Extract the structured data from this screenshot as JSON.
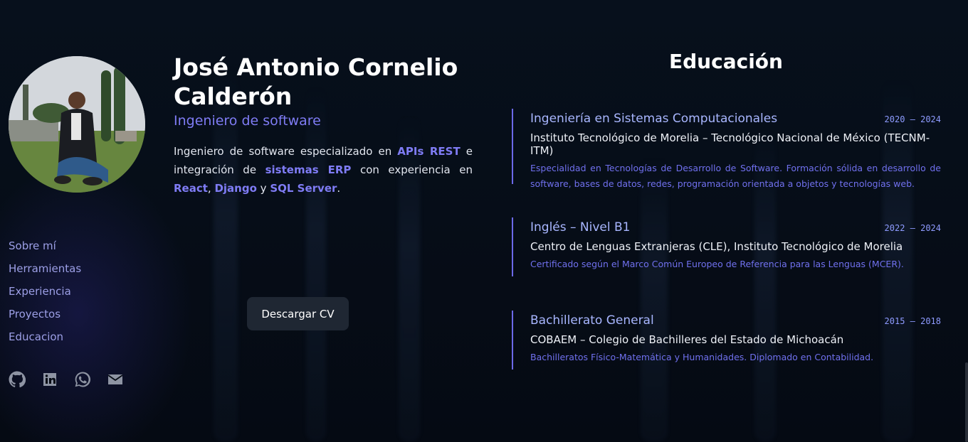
{
  "hero": {
    "name": "José Antonio Cornelio Calderón",
    "role": "Ingeniero de software",
    "bio": {
      "t1": "Ingeniero de software especializado en ",
      "h1": "APIs REST",
      "t2": " e integración de ",
      "h2": "sistemas ERP",
      "t3": " con experiencia en ",
      "h3": "React",
      "t4": ", ",
      "h4": "Django",
      "t5": " y ",
      "h5": "SQL Server",
      "t6": "."
    },
    "cv_button": "Descargar CV"
  },
  "nav": {
    "items": [
      "Sobre mí",
      "Herramientas",
      "Experiencia",
      "Proyectos",
      "Educacion"
    ]
  },
  "socials": {
    "icons": [
      "github-icon",
      "linkedin-icon",
      "whatsapp-icon",
      "mail-icon"
    ],
    "icon_color": "#8e94a3"
  },
  "education": {
    "title": "Educación",
    "items": [
      {
        "degree": "Ingeniería en Sistemas Computacionales",
        "years": "2020 – 2024",
        "school": "Instituto Tecnológico de Morelia – Tecnológico Nacional de México (TECNM-ITM)",
        "description": "Especialidad en Tecnologías de Desarrollo de Software. Formación sólida en desarrollo de software, bases de datos, redes, programación orientada a objetos y tecnologías web."
      },
      {
        "degree": "Inglés – Nivel B1",
        "years": "2022 – 2024",
        "school": "Centro de Lenguas Extranjeras (CLE), Instituto Tecnológico de Morelia",
        "description": "Certificado según el Marco Común Europeo de Referencia para las Lenguas (MCER)."
      },
      {
        "degree": "Bachillerato General",
        "years": "2015 – 2018",
        "school": "COBAEM – Colegio de Bachilleres del Estado de Michoacán",
        "description": "Bachilleratos Físico-Matemática y Humanidades. Diplomado en Contabilidad."
      }
    ]
  },
  "colors": {
    "accent": "#7f7cf5",
    "background": "#060b14",
    "timeline": "#6c69e8"
  }
}
